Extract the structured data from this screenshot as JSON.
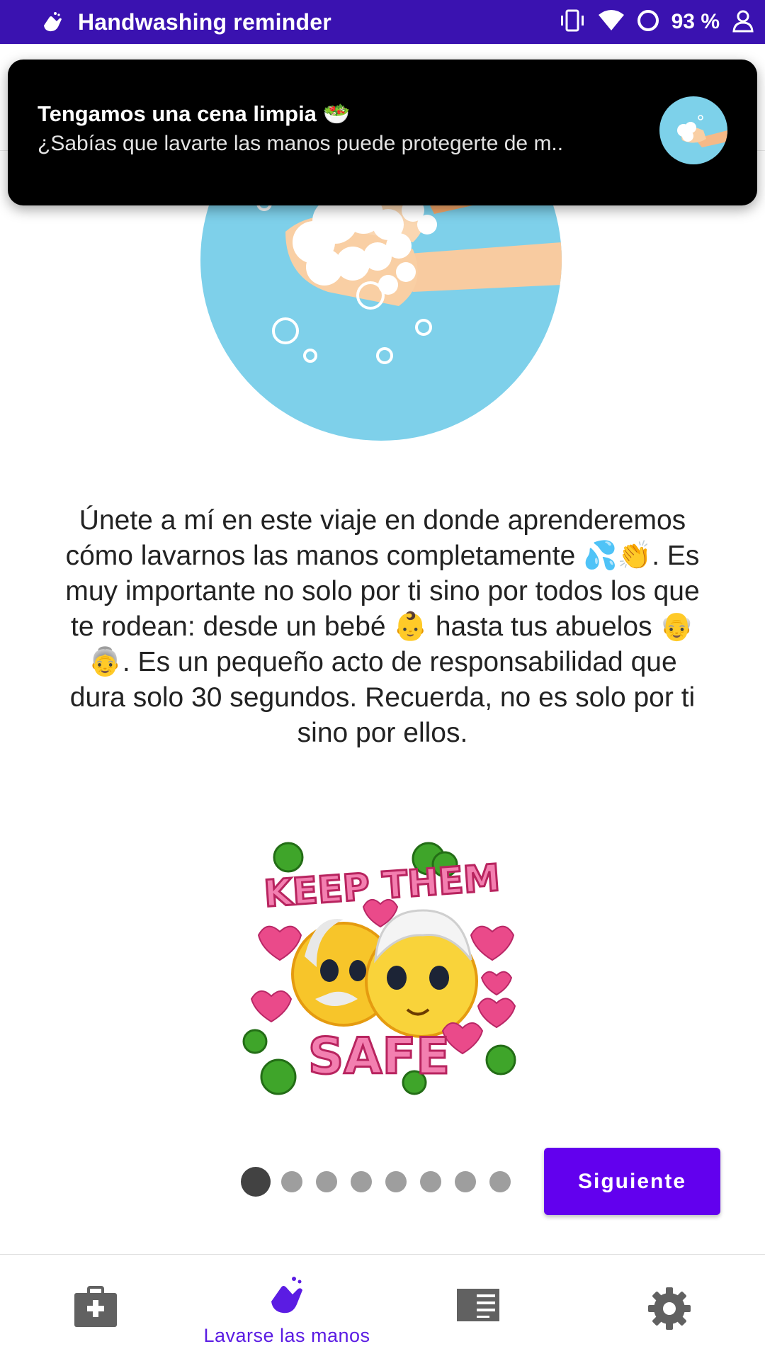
{
  "status_bar": {
    "app_title": "Handwashing reminder",
    "battery": "93 %",
    "icons": [
      "hand-wash-icon",
      "vibrate-icon",
      "wifi-icon",
      "battery-ring-icon",
      "vpn-person-icon"
    ]
  },
  "notification": {
    "title": "Tengamos una cena limpia 🥗",
    "body": "¿Sabías que lavarte las manos puede protegerte de m.."
  },
  "intro": {
    "text": "Únete a mí en este viaje en donde aprenderemos cómo lavarnos las manos completamente 💦👏. Es muy importante no solo por ti sino por todos los que te rodean: desde un bebé 👶 hasta tus abuelos 👴👵. Es un pequeño acto de responsabilidad que dura solo 30 segundos. Recuerda, no es solo por ti sino por ellos."
  },
  "sticker": {
    "line1": "KEEP THEM",
    "line2": "SAFE"
  },
  "pager": {
    "total": 8,
    "current": 1
  },
  "next_button": {
    "label": "Siguiente"
  },
  "bottom_nav": {
    "items": [
      {
        "icon": "first-aid-kit-icon",
        "label": ""
      },
      {
        "icon": "hand-wash-icon",
        "label": "Lavarse las manos",
        "active": true
      },
      {
        "icon": "news-icon",
        "label": ""
      },
      {
        "icon": "settings-gear-icon",
        "label": ""
      }
    ]
  },
  "colors": {
    "status_bar": "#3a12b0",
    "accent": "#6200ee",
    "nav_active": "#5b1ce3",
    "hero_circle": "#7ed0ea"
  }
}
